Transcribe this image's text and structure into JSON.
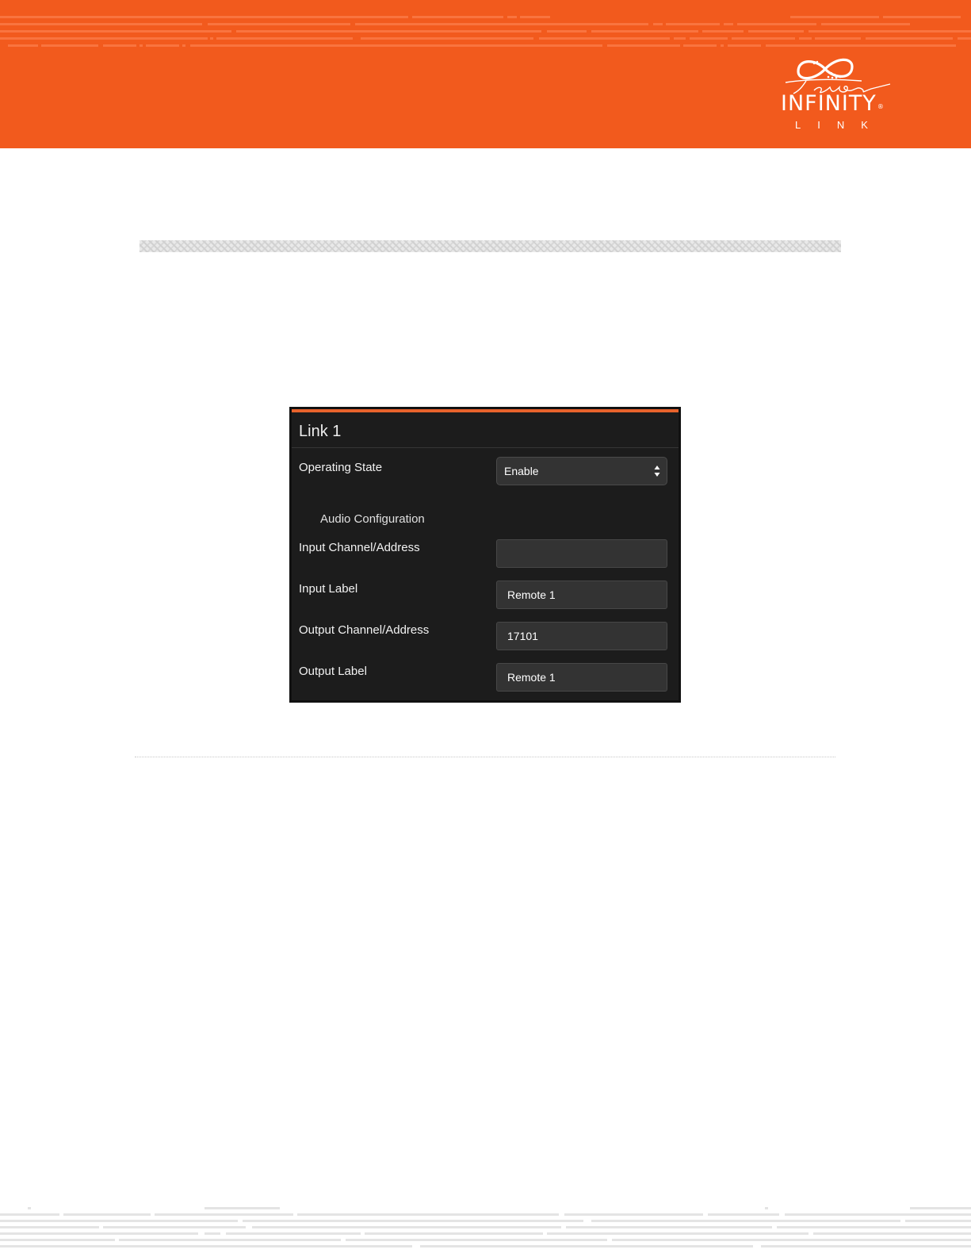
{
  "theme": {
    "brand": "#f25a1d",
    "accent": "#e8632c",
    "panel_bg": "#1c1c1c",
    "field_bg": "#333333"
  },
  "logo": {
    "script_text": "Telos",
    "brand_name": "INFINITY",
    "registered_mark": "®",
    "sub_brand": "LINK",
    "icons": [
      "infinity-mark-icon"
    ]
  },
  "panel": {
    "title": "Link 1",
    "operating_state": {
      "label": "Operating State",
      "value": "Enable"
    },
    "section_label": "Audio Configuration",
    "input_channel": {
      "label": "Input Channel/Address",
      "value": ""
    },
    "input_label": {
      "label": "Input Label",
      "value": "Remote 1"
    },
    "output_channel": {
      "label": "Output Channel/Address",
      "value": "17101"
    },
    "output_label": {
      "label": "Output Label",
      "value": "Remote 1"
    }
  }
}
